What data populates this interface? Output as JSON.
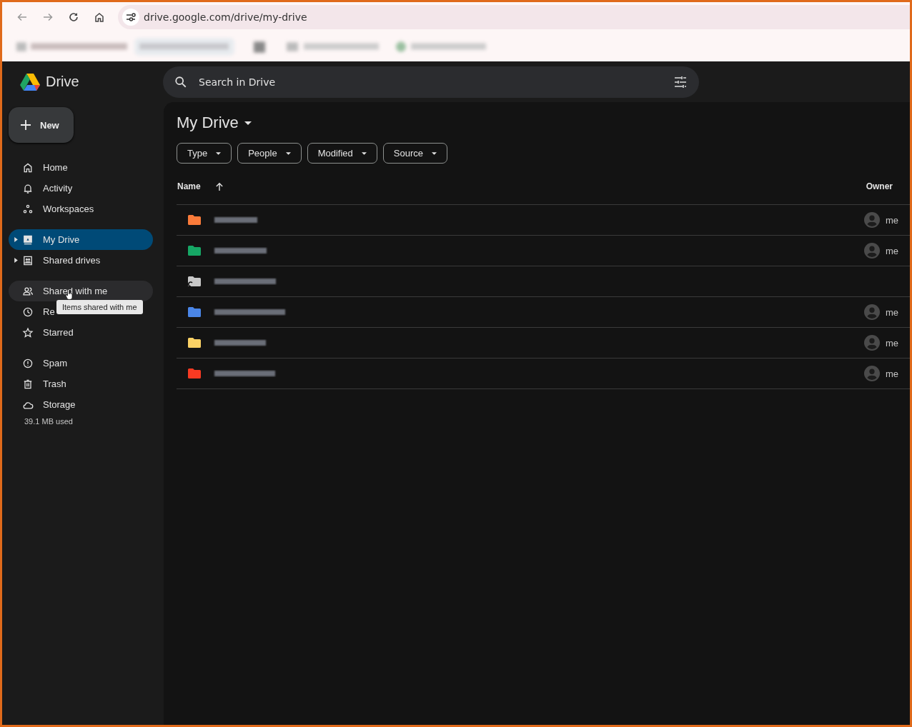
{
  "browser": {
    "url": "drive.google.com/drive/my-drive"
  },
  "app": {
    "name": "Drive"
  },
  "search": {
    "placeholder": "Search in Drive"
  },
  "new_button": {
    "label": "New"
  },
  "sidebar": {
    "sections": [
      [
        {
          "label": "Home",
          "selected": false,
          "hovered": false,
          "expandable": false
        },
        {
          "label": "Activity",
          "selected": false,
          "hovered": false,
          "expandable": false
        },
        {
          "label": "Workspaces",
          "selected": false,
          "hovered": false,
          "expandable": false
        }
      ],
      [
        {
          "label": "My Drive",
          "selected": true,
          "hovered": false,
          "expandable": true
        },
        {
          "label": "Shared drives",
          "selected": false,
          "hovered": false,
          "expandable": true
        }
      ],
      [
        {
          "label": "Shared with me",
          "selected": false,
          "hovered": true,
          "expandable": false
        },
        {
          "label": "Re",
          "selected": false,
          "hovered": false,
          "expandable": false
        },
        {
          "label": "Starred",
          "selected": false,
          "hovered": false,
          "expandable": false
        }
      ],
      [
        {
          "label": "Spam",
          "selected": false,
          "hovered": false,
          "expandable": false
        },
        {
          "label": "Trash",
          "selected": false,
          "hovered": false,
          "expandable": false
        },
        {
          "label": "Storage",
          "selected": false,
          "hovered": false,
          "expandable": false
        }
      ]
    ],
    "storage_used": "39.1 MB used"
  },
  "tooltip": "Items shared with me",
  "main": {
    "title": "My Drive",
    "filters": [
      "Type",
      "People",
      "Modified",
      "Source"
    ],
    "columns": {
      "name": "Name",
      "owner": "Owner"
    },
    "rows": [
      {
        "kind": "folder",
        "color": "#fa7b3a",
        "owner": "me"
      },
      {
        "kind": "folder",
        "color": "#16a765",
        "owner": "me"
      },
      {
        "kind": "shared-folder",
        "color": "#c8c8c8"
      },
      {
        "kind": "folder",
        "color": "#4a86e8",
        "owner": "me"
      },
      {
        "kind": "folder",
        "color": "#fad165",
        "owner": "me"
      },
      {
        "kind": "folder",
        "color": "#f83a22",
        "owner": "me"
      }
    ]
  }
}
